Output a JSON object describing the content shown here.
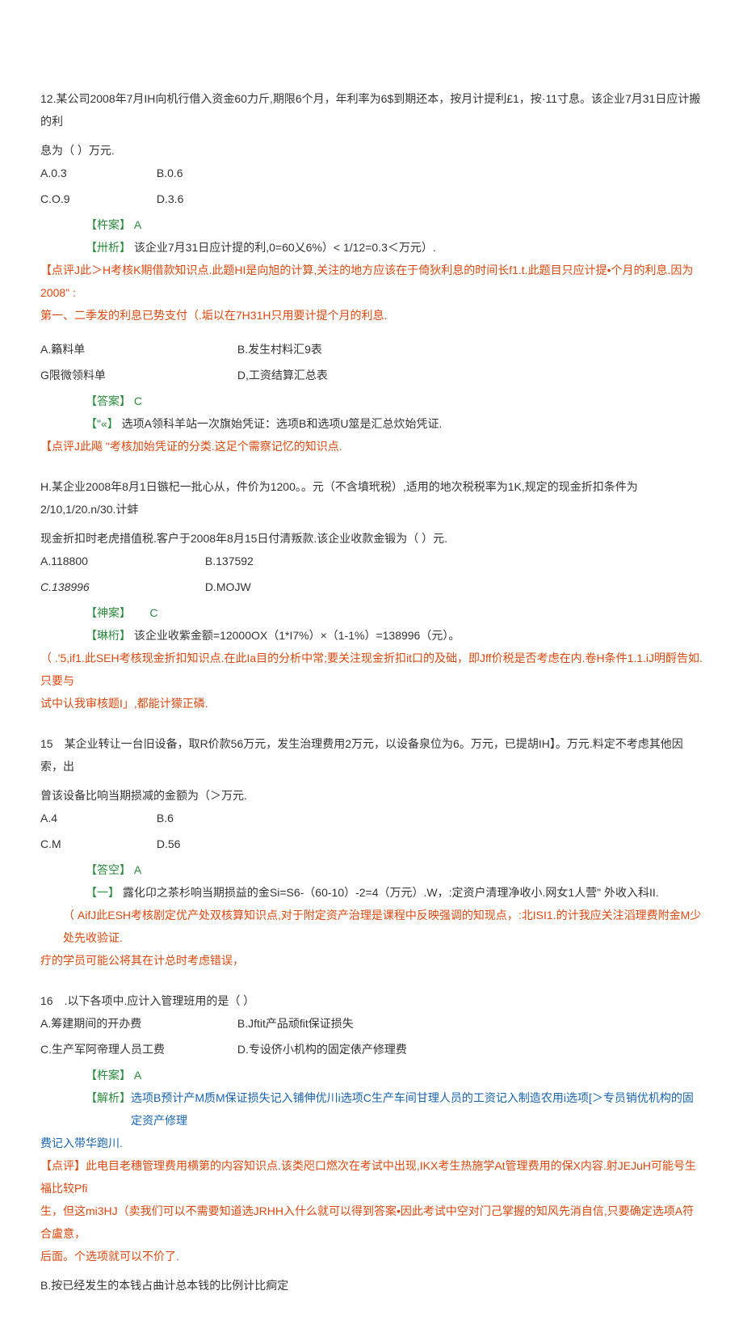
{
  "q12": {
    "stem_a": "12.某公司2008年7月IH向机行借入资金60力斤,期限6个月，年利率为6$到期还本，按月计提利£1，按·11寸息。该企业7月31日应计搬的利",
    "stem_b": "息为（  ）万元.",
    "optA": "A.0.3",
    "optB": "B.0.6",
    "optC": "C.O.9",
    "optD": "D.3.6",
    "ans_bracket": "【杵案】",
    "ans_val": "A",
    "parse_bracket": "【卅析】",
    "parse_text": "该企业7月31日应计提的利,0=60乂6%）< 1/12=0.3＜万元）.",
    "comment_a": "【点评J此＞H考核K期借款知识点.此题HI是向旭的计算,关注的地方应该在于倚狄利息的时间长f1.t.此题目只应计提•个月的利息.因为2008\" :",
    "comment_b": "第一、二季发的利息已势支付（.垢以在7H31H只用要计提个月的利息."
  },
  "q13": {
    "optA": "A.籟料单",
    "optB": "B.发生村料汇9表",
    "optC": "G限微领料单",
    "optD": "D,工资结算汇总表",
    "ans_bracket": "【答案】",
    "ans_val": "C",
    "parse_bracket": "【\"«】",
    "parse_text": "选项A领科羊站一次旗始凭证：选项B和选项U筮是汇总炊始凭证.",
    "comment": "【点评J此飚  \"考核加始凭证的分类.这足个需察记忆的知识点."
  },
  "q14": {
    "stem_a": "H.某企业2008年8月1日镞杞一批心从，件价为1200。。元（不含墳玳税）,适用的地次税税率为1K,规定的现金折扣条件为2/10,1/20.n/30.计蚌",
    "stem_b": "现金折扣时老虎措值税.客户于2008年8月15日付清叛款.该企业收款金锻为（ ）元.",
    "optA": "A.118800",
    "optB": "B.137592",
    "optC": "C.138996",
    "optD": "D.MOJW",
    "ans_bracket": "【神案】",
    "ans_val": "C",
    "parse_bracket": "【琳桁】",
    "parse_text": "该企业收紫金额=12000OX（1*I7%）×（1-1%）=138996（元）。",
    "comment_a": "（ .'5,if1.此SEH考核现金折扣知识点.在此Ia目的分析中常;要关注现金折扣it口的及础，即Jff价税是否考虑在内.卷H条件1.1.iJ明酹告如.只要与",
    "comment_b": "试中认我审核题I」,都能计獴正磷."
  },
  "q15": {
    "stem_a": "15　某企业转让一台旧设备，取R价款56万元，发生治理费用2万元，以设备泉位为6。万元，已提胡IH】。万元.料定不考虑其他因索，出",
    "stem_b": "曾该设备比响当期损减的金额为（＞万元.",
    "optA": "A.4",
    "optB": "B.6",
    "optC": "C.M",
    "optD": "D.56",
    "ans_bracket": "【答空】",
    "ans_val": "A",
    "parse_bracket": "【一】",
    "parse_text": "露化卬之茶杉响当期损益的金Si=S6-（60-10）-2=4（万元）.W，:定资户清理净收小.网女1人营\"  外收入科II.",
    "comment_a": "（ AifJ此ESH考核剧定优产处双核算知识点,对于附定资产治理是课程中反映强调的知现点，:北ISI1.的计我应关注滔理费附金M少处先收验证.",
    "comment_b": "疔的学员可能公将其在计总时考虑错误，"
  },
  "q16": {
    "stem": "16　.以下各项中.应计入管理班用的是（ ）",
    "optA": "A.筹建期间的开办费",
    "optB": "B.Jftit产品顽fit保证损失",
    "optC": "C.生产军阿帝理人员工费",
    "optD": "D.专设侪小机构的固定俵产修理费",
    "ans_bracket": "【杵案】",
    "ans_val": "A",
    "parse_bracket": "【解析】",
    "parse_text_a": "选项B预计产M质M保证损失记入铺伸优川i选项C生产车间甘理人员的工资记入制造农用i选项[＞专员销优机构的固定资产修理",
    "parse_text_b": "费记入带华跑川.",
    "comment_a": "【点评】此电目老穗管理费用横第的内容知识点.该类咫口燃次在考试中出现,IKX考生热施学At管理费用的保X内容.射JEJuH可能号生福比较Pfi",
    "comment_b": "生，但这mi3HJ（卖我们可以不需要知道选JRHH入什么就可以得到答案•因此考试中空对门己掌握的知风先消自信,只要确定选项A符合盧意，",
    "comment_c": "后面。个选项就可以不价了.",
    "tail": "B.按已经发生的本钱占曲计总本钱的比例计比痾定"
  }
}
